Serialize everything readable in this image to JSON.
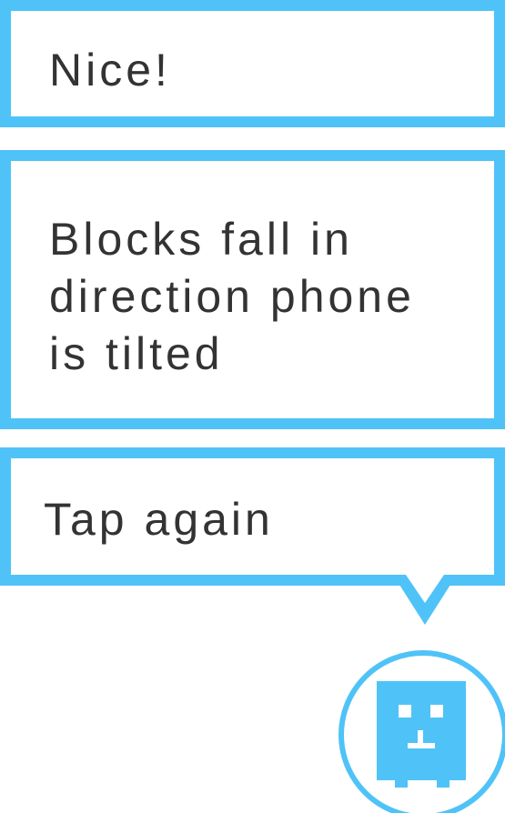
{
  "tutorial": {
    "messages": [
      {
        "text": "Nice!"
      },
      {
        "text": "Blocks fall in\ndirection phone\nis tilted"
      },
      {
        "text": "Tap again"
      }
    ]
  },
  "colors": {
    "accent": "#4fc3f7",
    "text": "#333333",
    "background": "#ffffff"
  },
  "avatar": {
    "icon": "robot-face-icon"
  }
}
